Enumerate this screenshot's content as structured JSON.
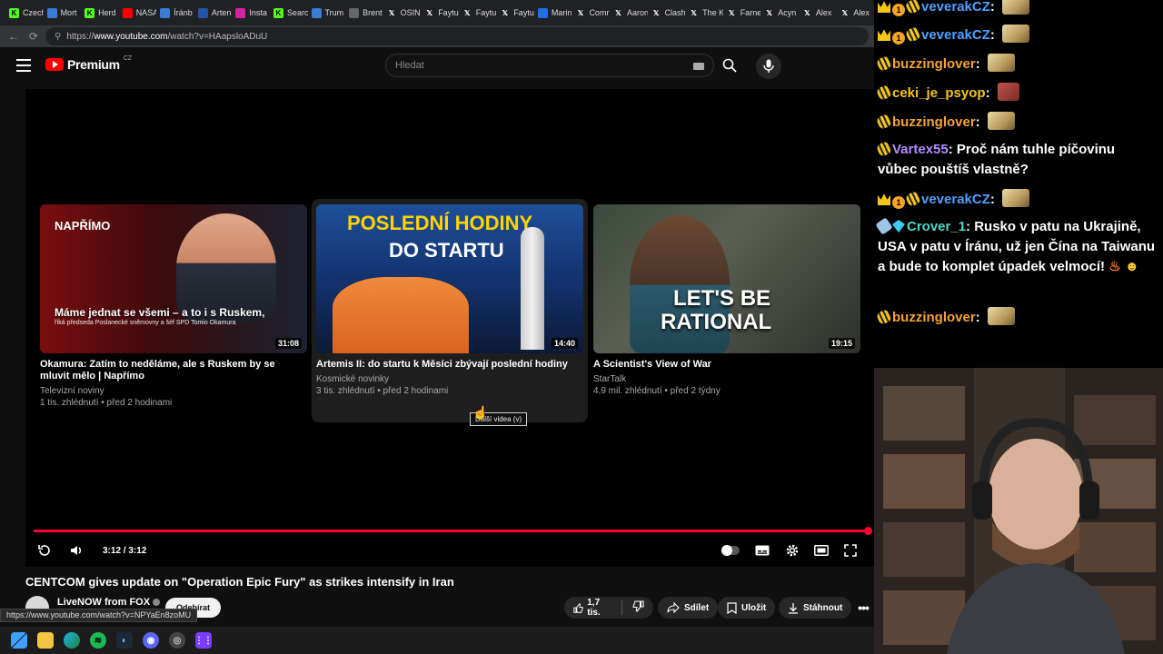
{
  "browser": {
    "tabs": [
      {
        "label": "Czech",
        "icon": "k-icon",
        "color": "#53fc18"
      },
      {
        "label": "Mort",
        "icon": "generic-icon",
        "color": "#3a7bd5"
      },
      {
        "label": "Herd",
        "icon": "k-icon",
        "color": "#53fc18"
      },
      {
        "label": "NASA",
        "icon": "youtube-icon",
        "color": "#ff0000"
      },
      {
        "label": "Íránb",
        "icon": "generic-icon",
        "color": "#3a7bd5"
      },
      {
        "label": "Arten",
        "icon": "generic-icon",
        "color": "#2255aa"
      },
      {
        "label": "Insta",
        "icon": "instagram-icon",
        "color": "#d6249f"
      },
      {
        "label": "Searc",
        "icon": "k-icon",
        "color": "#53fc18"
      },
      {
        "label": "Trum",
        "icon": "generic-icon",
        "color": "#3a7bd5"
      },
      {
        "label": "Brent",
        "icon": "globe-icon",
        "color": "#666666"
      },
      {
        "label": "OSIN",
        "icon": "x-icon",
        "color": "#000000"
      },
      {
        "label": "Faytu",
        "icon": "x-icon",
        "color": "#000000"
      },
      {
        "label": "Faytu",
        "icon": "x-icon",
        "color": "#000000"
      },
      {
        "label": "Faytu",
        "icon": "x-icon",
        "color": "#000000"
      },
      {
        "label": "Marin",
        "icon": "generic-icon",
        "color": "#1f6feb"
      },
      {
        "label": "Comr",
        "icon": "x-icon",
        "color": "#000000"
      },
      {
        "label": "Aaron",
        "icon": "x-icon",
        "color": "#000000"
      },
      {
        "label": "Clash",
        "icon": "x-icon",
        "color": "#000000"
      },
      {
        "label": "The K",
        "icon": "x-icon",
        "color": "#000000"
      },
      {
        "label": "Farne",
        "icon": "x-icon",
        "color": "#000000"
      },
      {
        "label": "Acyn",
        "icon": "x-icon",
        "color": "#000000"
      },
      {
        "label": "Alex",
        "icon": "x-icon",
        "color": "#000000"
      },
      {
        "label": "Alex",
        "icon": "x-icon",
        "color": "#000000"
      }
    ],
    "url_prefix": "https://",
    "url_host": "www.youtube.com",
    "url_path": "/watch?v=HAapsloADuU",
    "status_url": "https://www.youtube.com/watch?v=NPYaEn8zoMU"
  },
  "youtube": {
    "logo_text": "Premium",
    "logo_region": "CZ",
    "search_placeholder": "Hledat",
    "endscreen": [
      {
        "title": "Okamura: Zatím to neděláme, ale s Ruskem by se mluvit mělo | Napřímo",
        "channel": "Televizní noviny",
        "stats": "1 tis. zhlédnutí • před 2 hodinami",
        "duration": "31:08",
        "thumb_headline": "Máme jednat se všemi – a to i s Ruskem,",
        "thumb_sub": "říká předseda Poslanecké sněmovny a šéf SPD Tomio Okamura",
        "thumb_tag": "NAPŘÍMO"
      },
      {
        "title": "Artemis II: do startu k Měsíci zbývají poslední hodiny",
        "channel": "Kosmické novinky",
        "stats": "3 tis. zhlédnutí • před 2 hodinami",
        "duration": "14:40",
        "thumb_line1": "POSLEDNÍ HODINY",
        "thumb_line2": "DO STARTU"
      },
      {
        "title": "A Scientist's View of War",
        "channel": "StarTalk",
        "stats": "4,9 mil. zhlédnutí • před 2 týdny",
        "duration": "19:15",
        "thumb_line1": "LET'S BE",
        "thumb_line2": "RATIONAL"
      }
    ],
    "tooltip": "Další videa (v)",
    "time": "3:12 / 3:12",
    "progress_fraction": 1.0,
    "video_title": "CENTCOM gives update on \"Operation Epic Fury\" as strikes intensify in Iran",
    "channel_name": "LiveNOW from FOX",
    "subscribe_label": "Odebírat",
    "like_count": "1,7 tis.",
    "share_label": "Sdílet",
    "save_label": "Uložit",
    "download_label": "Stáhnout"
  },
  "chat": [
    {
      "user": "veverakCZ",
      "color": "#4fa0ff",
      "badges": [
        "crown-icon",
        "coin-icon",
        "bee-icon"
      ],
      "text": "",
      "emote": "cat"
    },
    {
      "user": "veverakCZ",
      "color": "#4fa0ff",
      "badges": [
        "crown-icon",
        "coin-icon",
        "bee-icon"
      ],
      "text": "",
      "emote": "cat"
    },
    {
      "user": "buzzinglover",
      "color": "#f0a33a",
      "badges": [
        "bee-icon"
      ],
      "text": "",
      "emote": "cat"
    },
    {
      "user": "ceki_je_psyop",
      "color": "#f5c518",
      "badges": [
        "bee-icon"
      ],
      "text": "",
      "emote": "face"
    },
    {
      "user": "buzzinglover",
      "color": "#f0a33a",
      "badges": [
        "bee-icon"
      ],
      "text": "",
      "emote": "cat"
    },
    {
      "user": "Vartex55",
      "color": "#b18cff",
      "badges": [
        "bee-icon"
      ],
      "text": "Proč nám tuhle píčovinu vůbec pouštíš vlastně?",
      "emote": ""
    },
    {
      "user": "veverakCZ",
      "color": "#4fa0ff",
      "badges": [
        "crown-icon",
        "coin-icon",
        "bee-icon"
      ],
      "text": "",
      "emote": "cat"
    },
    {
      "user": "Crover_1",
      "color": "#4fd8c4",
      "badges": [
        "rocket-icon",
        "gem-icon"
      ],
      "text": "Rusko v patu na Ukrajině, USA v patu v Íránu, už jen Čína na Taiwanu a bude to komplet úpadek velmocí!",
      "emote": ""
    },
    {
      "user": "buzzinglover",
      "color": "#f0a33a",
      "badges": [
        "bee-icon"
      ],
      "text": "",
      "emote": "cat"
    }
  ],
  "colors": {
    "accent": "#ff0033",
    "background": "#0f0f0f"
  }
}
